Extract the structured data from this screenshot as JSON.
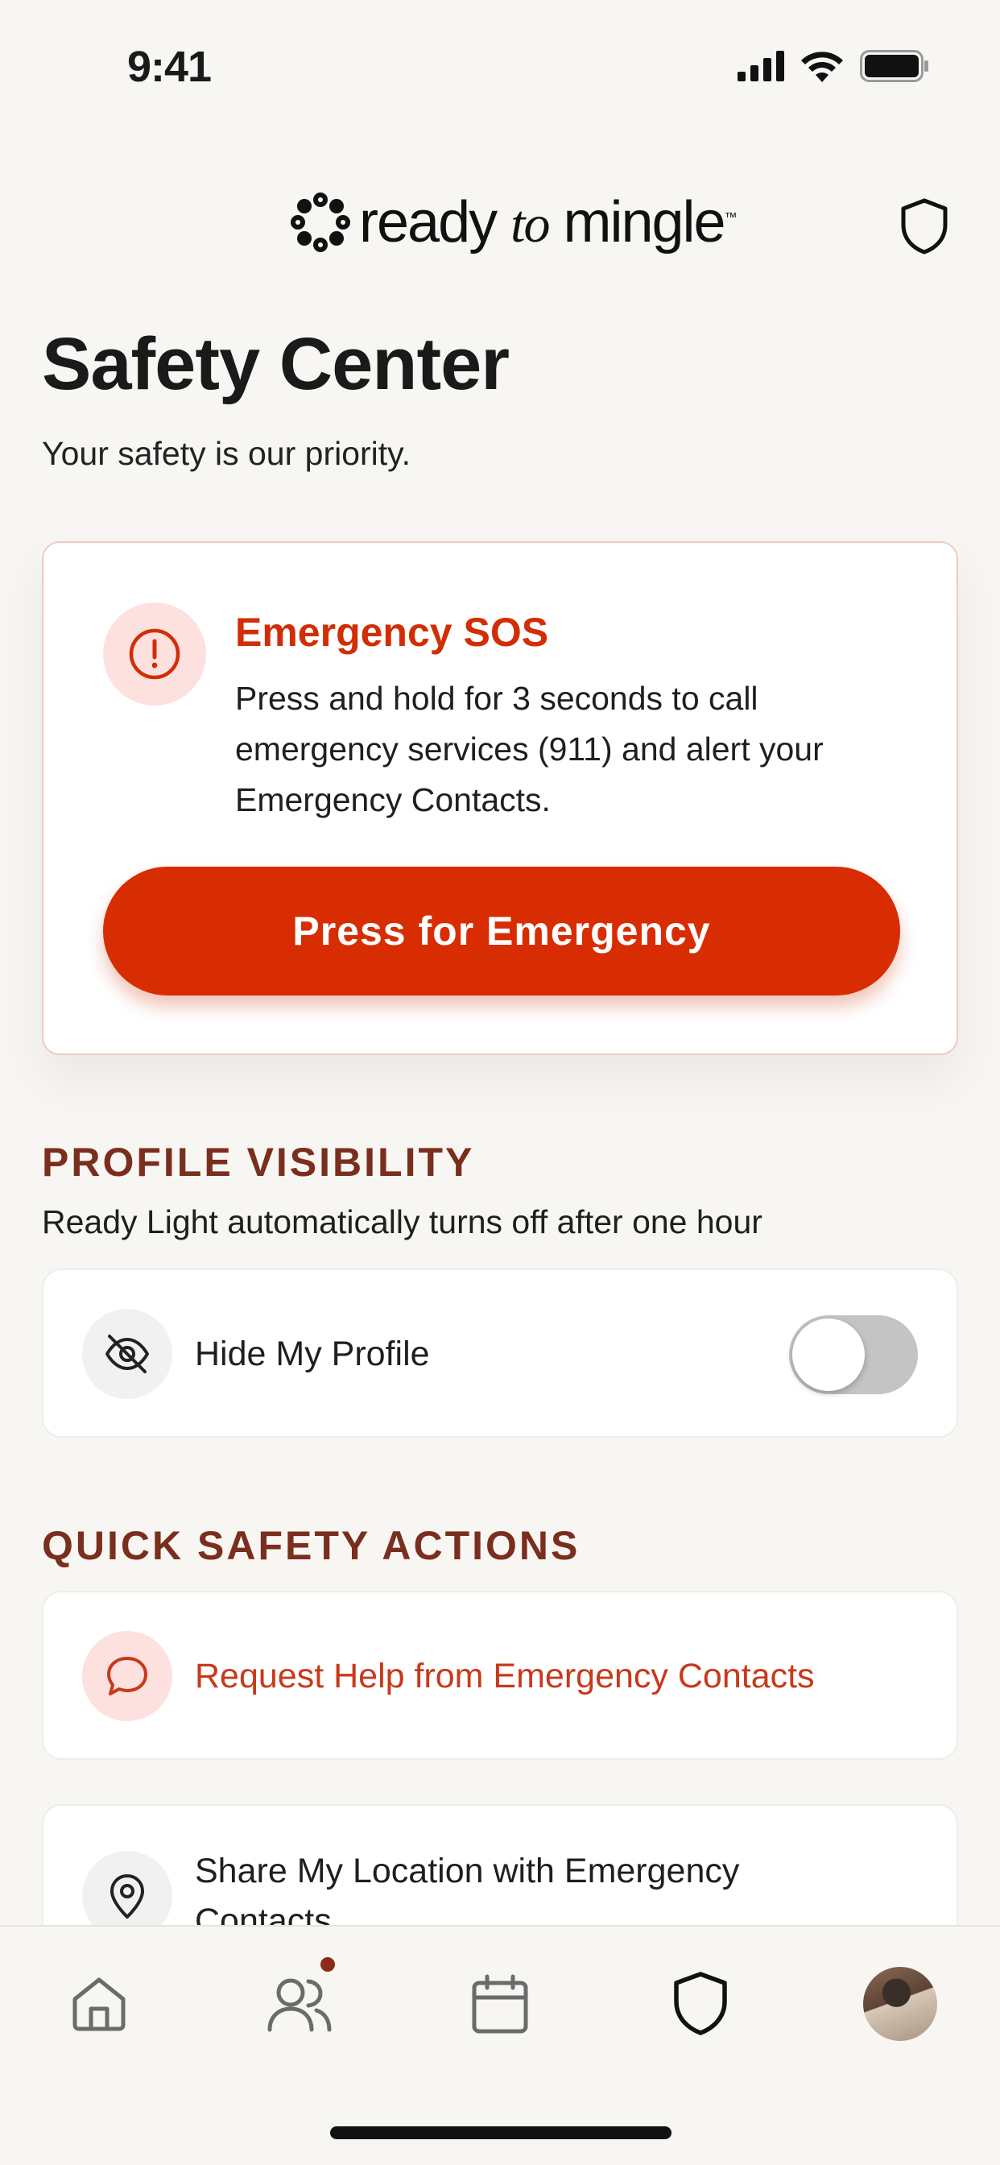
{
  "status_bar": {
    "time": "9:41"
  },
  "header": {
    "logo": {
      "part1": "ready",
      "part2": "to",
      "part3": "mingle",
      "tm": "™"
    },
    "shield_icon": "shield-icon"
  },
  "page": {
    "title": "Safety Center",
    "subtitle": "Your safety is our priority."
  },
  "sos": {
    "title": "Emergency SOS",
    "description": "Press and hold for 3 seconds to call emergency services (911) and alert your Emergency Contacts.",
    "button_label": "Press for Emergency",
    "icon": "alert-circle-icon",
    "accent_color": "#d82d02"
  },
  "profile_visibility": {
    "heading": "PROFILE VISIBILITY",
    "description": "Ready Light automatically turns off after one hour",
    "row_label": "Hide My Profile",
    "icon": "eye-off-icon",
    "toggle_on": false
  },
  "quick_actions": {
    "heading": "QUICK SAFETY ACTIONS",
    "items": [
      {
        "label": "Request Help from Emergency Contacts",
        "icon": "chat-bubble-icon",
        "color": "#c8391a"
      },
      {
        "label": "Share My Location with Emergency Contacts",
        "icon": "location-pin-icon",
        "color": "#1a1a1a"
      }
    ]
  },
  "tab_bar": {
    "tabs": [
      {
        "name": "home",
        "icon": "home-icon"
      },
      {
        "name": "people",
        "icon": "people-icon",
        "badge": true
      },
      {
        "name": "calendar",
        "icon": "calendar-icon"
      },
      {
        "name": "safety",
        "icon": "shield-icon",
        "active": true
      },
      {
        "name": "profile",
        "icon": "avatar"
      }
    ]
  }
}
